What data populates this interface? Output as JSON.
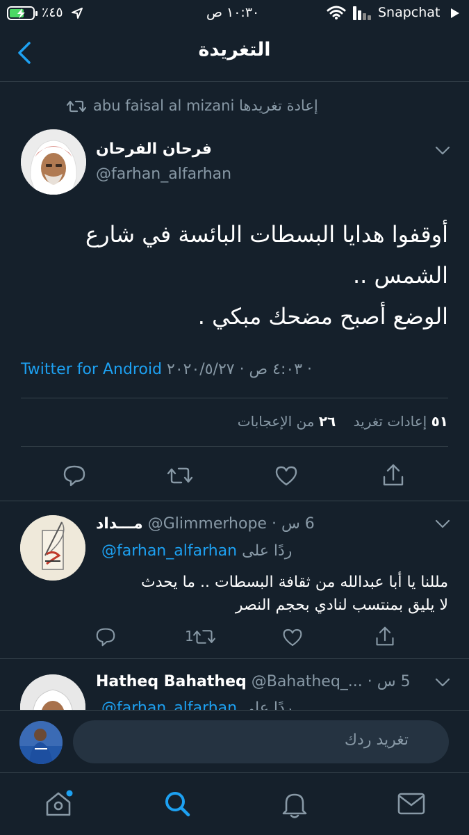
{
  "status_bar": {
    "battery": "٪٤٥",
    "time": "١٠:٣٠ ص",
    "carrier": "Snapchat"
  },
  "header": {
    "title": "التغريدة"
  },
  "retweet": {
    "text": "abu faisal al mizani إعادة تغريدها"
  },
  "tweet": {
    "author_name": "فرحان الفرحان",
    "author_handle": "@farhan_alfarhan",
    "text_line1": "أوقفوا هدايا البسطات البائسة في شارع",
    "text_line2": "الشمس ..",
    "text_line3": "الوضع أصبح مضحك مبكي .",
    "time_date": "٤:٠٣ ص · ٢٠٢٠/٥/٢٧ ·",
    "source": "Twitter for Android",
    "likes_count": "٢٦",
    "likes_label": "من الإعجابات",
    "retweets_count": "٥١",
    "retweets_label": "إعادات تغريد"
  },
  "replies": [
    {
      "name": "مـــداد",
      "handle": "@Glimmerhope",
      "time": "6 س ·",
      "reply_to_label": "ردًا على",
      "reply_to_handle": "@farhan_alfarhan",
      "text_line1": "مللنا يا أبا عبدالله من ثقافة البسطات .. ما يحدث",
      "text_line2": "لا يليق بمنتسب لنادي بحجم النصر",
      "retweet_count": "1"
    },
    {
      "name": "Hatheq Bahatheq",
      "handle": "@Bahatheq_...",
      "time": "5 س ·",
      "reply_to_label": "ردًا على",
      "reply_to_handle": "@farhan_alfarhan"
    }
  ],
  "compose": {
    "placeholder": "تغريد ردك"
  },
  "colors": {
    "background": "#15202b",
    "accent": "#1da1f2",
    "muted": "#8899a6",
    "divider": "#38444d"
  }
}
